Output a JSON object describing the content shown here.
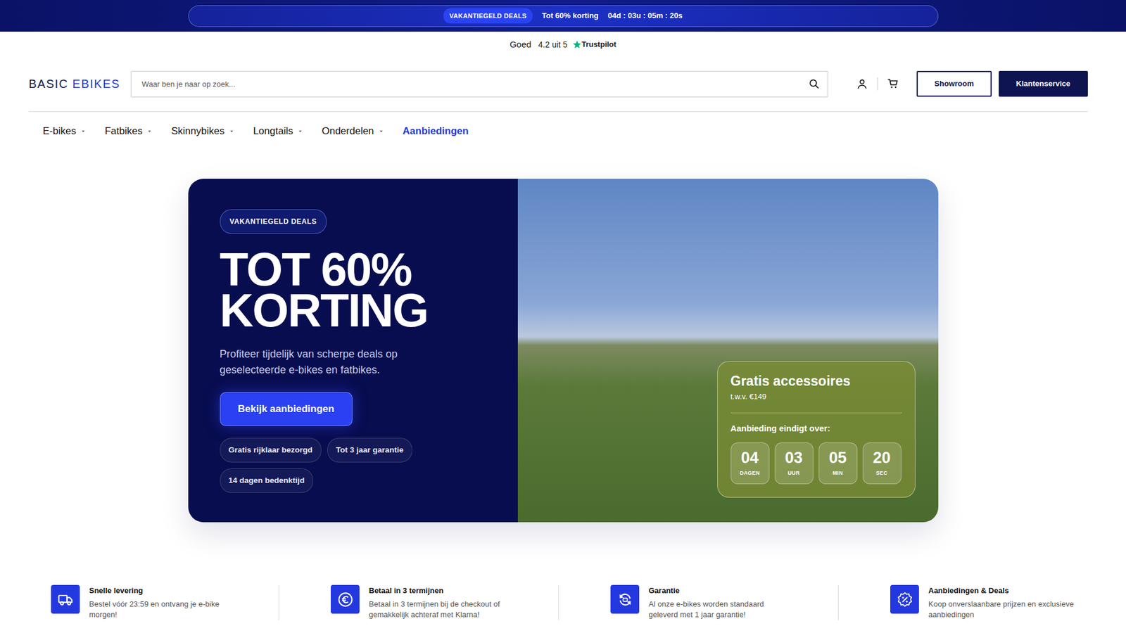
{
  "promo_bar": {
    "badge": "VAKANTIEGELD DEALS",
    "text": "Tot 60% korting",
    "countdown": "04d : 03u : 05m : 20s"
  },
  "trustpilot": {
    "label": "Goed",
    "score": "4.2 uit 5",
    "brand": "Trustpilot"
  },
  "header": {
    "logo": [
      "BASIC",
      "EBIKES"
    ],
    "search": {
      "placeholder": "Waar ben je naar op zoek..."
    },
    "buttons": [
      {
        "label": "Showroom",
        "kind": "outline"
      },
      {
        "label": "Klantenservice",
        "kind": "solid"
      }
    ]
  },
  "nav": [
    {
      "label": "E-bikes",
      "has_menu": true,
      "selected": false
    },
    {
      "label": "Fatbikes",
      "has_menu": true,
      "selected": false
    },
    {
      "label": "Skinnybikes",
      "has_menu": true,
      "selected": false
    },
    {
      "label": "Longtails",
      "has_menu": true,
      "selected": false
    },
    {
      "label": "Onderdelen",
      "has_menu": true,
      "selected": false
    },
    {
      "label": "Aanbiedingen",
      "has_menu": false,
      "selected": true
    }
  ],
  "hero": {
    "badge": "VAKANTIEGELD DEALS",
    "title_lines": [
      "TOT 60%",
      "KORTING"
    ],
    "text": "Profiteer tijdelijk van scherpe deals op geselecteerde e-bikes en fatbikes.",
    "button": "Bekijk aanbiedingen",
    "chips": [
      "Gratis rijklaar bezorgd",
      "Tot 3 jaar garantie",
      "14 dagen bedenktijd"
    ],
    "offer": {
      "title": "Gratis accessoires",
      "subtitle": "t.w.v. €149",
      "countdown_label": "Aanbieding eindigt over:",
      "countdown": [
        {
          "value": "04",
          "unit": "DAGEN"
        },
        {
          "value": "03",
          "unit": "UUR"
        },
        {
          "value": "05",
          "unit": "MIN"
        },
        {
          "value": "20",
          "unit": "SEC"
        }
      ]
    }
  },
  "features": [
    {
      "title": "Snelle levering",
      "text": "Bestel vóór 23:59 en ontvang je e-bike morgen!"
    },
    {
      "title": "Betaal in 3 termijnen",
      "text": "Betaal in 3 termijnen bij de checkout of gemakkelijk achteraf met Klarna!"
    },
    {
      "title": "Garantie",
      "text": "Al onze e-bikes worden standaard geleverd met 1 jaar garantie!"
    },
    {
      "title": "Aanbiedingen & Deals",
      "text": "Koop onverslaanbare prijzen en exclusieve aanbiedingen"
    }
  ]
}
